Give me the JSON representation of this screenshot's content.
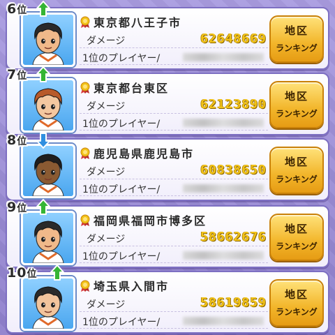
{
  "labels": {
    "damage": "ダメージ",
    "top_player": "1位のプレイヤー/",
    "button_line1": "地区",
    "button_line2": "ランキング"
  },
  "entries": [
    {
      "rank": "6",
      "rank_suffix": "位",
      "trend": "up",
      "region": "東京都八王子市",
      "damage": "62648669",
      "hair": "#2a2a2a",
      "skin": "#f0b98a"
    },
    {
      "rank": "7",
      "rank_suffix": "位",
      "trend": "up",
      "region": "東京都台東区",
      "damage": "62123890",
      "hair": "#b85a2a",
      "skin": "#f4c8a0"
    },
    {
      "rank": "8",
      "rank_suffix": "位",
      "trend": "down",
      "region": "鹿児島県鹿児島市",
      "damage": "60838650",
      "hair": "#1e1e1e",
      "skin": "#8a5a32"
    },
    {
      "rank": "9",
      "rank_suffix": "位",
      "trend": "up",
      "region": "福岡県福岡市博多区",
      "damage": "58662676",
      "hair": "#2a2a2a",
      "skin": "#f0b98a"
    },
    {
      "rank": "10",
      "rank_suffix": "位",
      "trend": "up",
      "region": "埼玉県入間市",
      "damage": "58619859",
      "hair": "#2a2a2a",
      "skin": "#f2c49c"
    }
  ],
  "colors": {
    "trend_up": "#35b535",
    "trend_down": "#2f8fe0",
    "damage_value": "#f2c318",
    "button": "#f2b52a",
    "background": "#9d8fd6"
  },
  "icons": {
    "region_medal": "medal-icon",
    "trend_up": "up-arrow-icon",
    "trend_down": "down-arrow-icon"
  }
}
